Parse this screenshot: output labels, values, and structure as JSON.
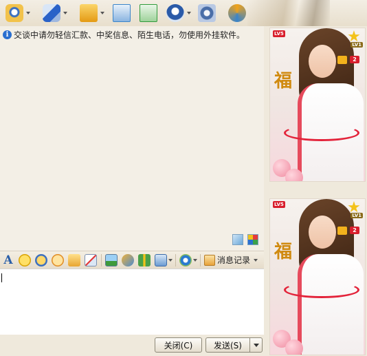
{
  "toolbar": {
    "buttons": [
      {
        "icon": "webcam-icon",
        "color": "#e0a41c",
        "has_dropdown": true
      },
      {
        "icon": "microphone-icon",
        "color": "#2a62c8",
        "has_dropdown": true
      },
      {
        "icon": "folder-transfer-icon",
        "color": "#e9a21b",
        "has_dropdown": true
      },
      {
        "icon": "mail-icon",
        "color": "#3a84c9",
        "has_dropdown": false
      },
      {
        "icon": "add-note-icon",
        "color": "#2f9a3a",
        "has_dropdown": false
      },
      {
        "icon": "remote-assist-icon",
        "color": "#2a5aa8",
        "has_dropdown": true
      },
      {
        "icon": "settings-icon",
        "color": "#4a6ea8",
        "has_dropdown": false
      },
      {
        "icon": "refresh-app-icon",
        "color": "#f0a21a",
        "has_dropdown": false
      }
    ]
  },
  "notice": {
    "text": "交谈中请勿轻信汇款、中奖信息、陌生电话，勿使用外挂软件。"
  },
  "format_bar": {
    "history_label": "消息记录"
  },
  "buttons": {
    "close": "关闭(C)",
    "send": "发送(S)"
  },
  "show_panels": [
    {
      "level_badge": "LV5",
      "vip_level": "LV1",
      "count": "2",
      "char": "福"
    },
    {
      "level_badge": "LV5",
      "vip_level": "LV1",
      "count": "2",
      "char": "福"
    }
  ]
}
